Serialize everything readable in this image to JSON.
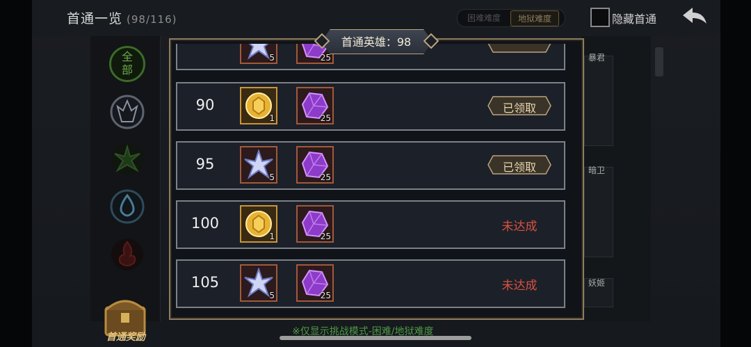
{
  "header": {
    "title": "首通一览",
    "count": "(98/116)",
    "difficulty_hard": "困难难度",
    "difficulty_hell": "地狱难度",
    "hide_label": "隐藏首通"
  },
  "left_nav": {
    "all_label": "全部",
    "chest_label": "首通奖励"
  },
  "right_col": {
    "hero1": "暴君",
    "hero2": "暗卫",
    "hero3": "妖姬"
  },
  "dialog": {
    "title": "首通英雄：98",
    "rows": [
      {
        "level": "90",
        "reward1": {
          "icon": "gold-coin-icon",
          "qty": "1"
        },
        "reward2": {
          "icon": "purple-gem-icon",
          "qty": "25"
        },
        "status": "已领取",
        "claimed": true
      },
      {
        "level": "95",
        "reward1": {
          "icon": "star-crystal-icon",
          "qty": "5"
        },
        "reward2": {
          "icon": "purple-gem-icon",
          "qty": "25"
        },
        "status": "已领取",
        "claimed": true
      },
      {
        "level": "100",
        "reward1": {
          "icon": "gold-coin-icon",
          "qty": "1"
        },
        "reward2": {
          "icon": "purple-gem-icon",
          "qty": "25"
        },
        "status": "未达成",
        "claimed": false
      },
      {
        "level": "105",
        "reward1": {
          "icon": "star-crystal-icon",
          "qty": "5"
        },
        "reward2": {
          "icon": "purple-gem-icon",
          "qty": "25"
        },
        "status": "未达成",
        "claimed": false
      }
    ],
    "partial_row": {
      "reward1_qty": "5",
      "reward2_qty": "25"
    }
  },
  "footer": {
    "note": "※仅显示挑战模式-困难/地狱难度"
  },
  "colors": {
    "accent_gold": "#b9a580",
    "status_unmet": "#d9513f",
    "note_green": "#4d9a46"
  }
}
